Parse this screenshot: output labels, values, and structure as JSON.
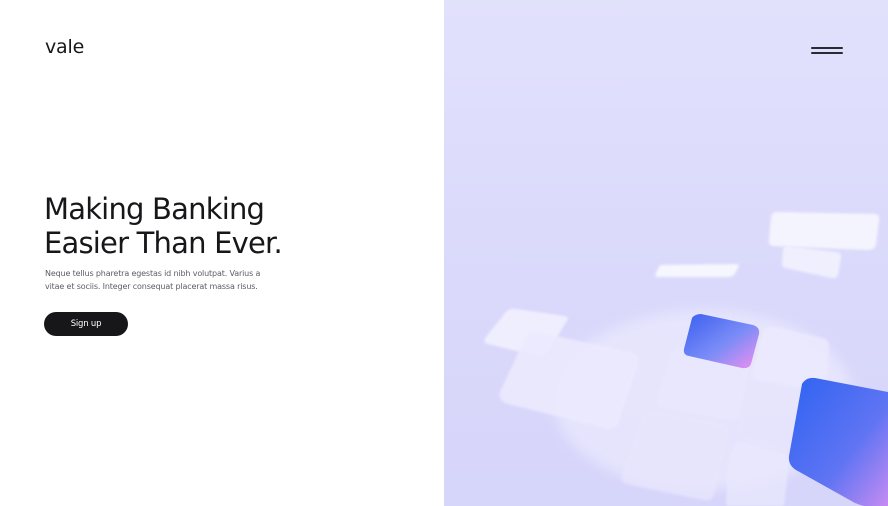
{
  "brand": {
    "name": "vale"
  },
  "hero": {
    "headline_line1": "Making Banking",
    "headline_line2": "Easier Than Ever.",
    "description_line1": "Neque tellus pharetra egestas id nibh volutpat. Varius a",
    "description_line2": "vitae et sociis. Integer consequat placerat massa risus.",
    "cta_label": "Sign up"
  },
  "colors": {
    "panel_background": "#dcdbfb",
    "button_background": "#17171a",
    "button_text": "#ffffff",
    "accent_blue": "#3f6ff0",
    "accent_pink": "#e78bf0"
  },
  "icons": {
    "menu": "hamburger-menu-icon"
  }
}
